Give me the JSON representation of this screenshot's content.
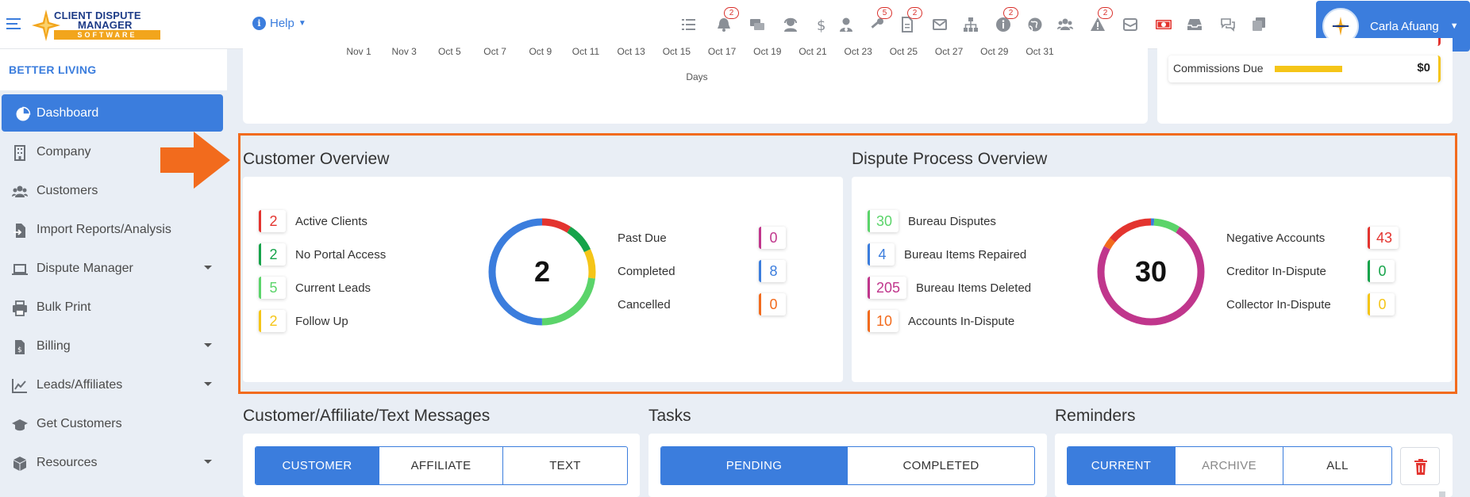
{
  "header": {
    "logo_line1": "CLIENT DISPUTE",
    "logo_line2": "MANAGER",
    "logo_band": "SOFTWARE",
    "help_label": "Help",
    "user_name": "Carla Afuang",
    "icon_badges": [
      {
        "icon": "tasks-icon",
        "badge": ""
      },
      {
        "icon": "bell-icon",
        "badge": "2"
      },
      {
        "icon": "messages-icon",
        "badge": ""
      },
      {
        "icon": "support-agent-icon",
        "badge": ""
      },
      {
        "icon": "dollar-icon",
        "badge": ""
      },
      {
        "icon": "user-tie-icon",
        "badge": ""
      },
      {
        "icon": "key-icon",
        "badge": "5"
      },
      {
        "icon": "document-icon",
        "badge": "2"
      },
      {
        "icon": "envelope-icon",
        "badge": ""
      },
      {
        "icon": "sitemap-icon",
        "badge": ""
      },
      {
        "icon": "info-icon",
        "badge": "2"
      },
      {
        "icon": "globe-icon",
        "badge": ""
      },
      {
        "icon": "users-icon",
        "badge": ""
      },
      {
        "icon": "warning-icon",
        "badge": "2"
      },
      {
        "icon": "mail-bulk-icon",
        "badge": ""
      },
      {
        "icon": "money-bill-icon",
        "badge": ""
      },
      {
        "icon": "inbox-icon",
        "badge": ""
      },
      {
        "icon": "comments-icon",
        "badge": ""
      },
      {
        "icon": "copy-icon",
        "badge": ""
      }
    ]
  },
  "sidebar": {
    "org_name": "BETTER LIVING",
    "items": [
      {
        "label": "Dashboard",
        "icon": "pie-chart-icon",
        "active": true,
        "caret": false
      },
      {
        "label": "Company",
        "icon": "building-icon",
        "active": false,
        "caret": false
      },
      {
        "label": "Customers",
        "icon": "users-icon",
        "active": false,
        "caret": false
      },
      {
        "label": "Import Reports/Analysis",
        "icon": "file-import-icon",
        "active": false,
        "caret": false
      },
      {
        "label": "Dispute Manager",
        "icon": "laptop-icon",
        "active": false,
        "caret": true
      },
      {
        "label": "Bulk Print",
        "icon": "printer-icon",
        "active": false,
        "caret": false
      },
      {
        "label": "Billing",
        "icon": "invoice-icon",
        "active": false,
        "caret": true
      },
      {
        "label": "Leads/Affiliates",
        "icon": "line-chart-icon",
        "active": false,
        "caret": true
      },
      {
        "label": "Get Customers",
        "icon": "graduation-cap-icon",
        "active": false,
        "caret": false
      },
      {
        "label": "Resources",
        "icon": "box-icon",
        "active": false,
        "caret": true
      }
    ]
  },
  "days_chart": {
    "x_ticks": [
      "Nov 1",
      "Nov 3",
      "Oct 5",
      "Oct 7",
      "Oct 9",
      "Oct 11",
      "Oct 13",
      "Oct 15",
      "Oct 17",
      "Oct 19",
      "Oct 21",
      "Oct 23",
      "Oct 25",
      "Oct 27",
      "Oct 29",
      "Oct 31"
    ],
    "x_label": "Days"
  },
  "commissions": {
    "label": "Commissions Due",
    "value": "$0",
    "bar_color": "#f5c518"
  },
  "customer_overview": {
    "title": "Customer Overview",
    "left_stats": [
      {
        "value": "2",
        "label": "Active Clients",
        "color": "#e3342f"
      },
      {
        "value": "2",
        "label": "No Portal Access",
        "color": "#16a34a"
      },
      {
        "value": "5",
        "label": "Current Leads",
        "color": "#5bd46a"
      },
      {
        "value": "2",
        "label": "Follow Up",
        "color": "#f5c518"
      }
    ],
    "donut_center": "2",
    "donut_segments": [
      {
        "fraction": 0.09,
        "color": "#e3342f"
      },
      {
        "fraction": 0.09,
        "color": "#16a34a"
      },
      {
        "fraction": 0.09,
        "color": "#f5c518"
      },
      {
        "fraction": 0.23,
        "color": "#5bd46a"
      },
      {
        "fraction": 0.5,
        "color": "#3b7ddd"
      }
    ],
    "right_stats": [
      {
        "value": "0",
        "label": "Past Due",
        "color": "#c0368c"
      },
      {
        "value": "8",
        "label": "Completed",
        "color": "#3b7ddd"
      },
      {
        "value": "0",
        "label": "Cancelled",
        "color": "#f26b1d"
      }
    ]
  },
  "dispute_overview": {
    "title": "Dispute Process Overview",
    "left_stats": [
      {
        "value": "30",
        "label": "Bureau Disputes",
        "color": "#5bd46a"
      },
      {
        "value": "4",
        "label": "Bureau Items Repaired",
        "color": "#3b7ddd"
      },
      {
        "value": "205",
        "label": "Bureau Items Deleted",
        "color": "#c0368c"
      },
      {
        "value": "10",
        "label": "Accounts In-Dispute",
        "color": "#f26b1d"
      }
    ],
    "donut_center": "30",
    "donut_segments": [
      {
        "fraction": 0.01,
        "color": "#3b7ddd"
      },
      {
        "fraction": 0.08,
        "color": "#5bd46a"
      },
      {
        "fraction": 0.74,
        "color": "#c0368c"
      },
      {
        "fraction": 0.03,
        "color": "#f26b1d"
      },
      {
        "fraction": 0.14,
        "color": "#e3342f"
      }
    ],
    "right_stats": [
      {
        "value": "43",
        "label": "Negative Accounts",
        "color": "#e3342f"
      },
      {
        "value": "0",
        "label": "Creditor In-Dispute",
        "color": "#16a34a"
      },
      {
        "value": "0",
        "label": "Collector In-Dispute",
        "color": "#f5c518"
      }
    ]
  },
  "messages": {
    "title": "Customer/Affiliate/Text Messages",
    "tabs": [
      "CUSTOMER",
      "AFFILIATE",
      "TEXT"
    ]
  },
  "tasks": {
    "title": "Tasks",
    "tabs": [
      "PENDING",
      "COMPLETED"
    ]
  },
  "reminders": {
    "title": "Reminders",
    "tabs": [
      "CURRENT",
      "ARCHIVE",
      "ALL"
    ]
  }
}
